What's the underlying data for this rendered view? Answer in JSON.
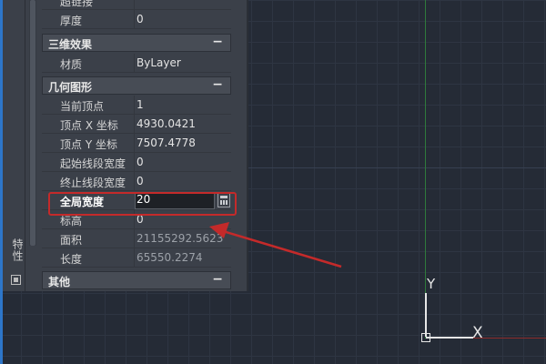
{
  "properties": {
    "rows_top": [
      {
        "label": "超链接",
        "value": ""
      },
      {
        "label": "厚度",
        "value": "0"
      }
    ],
    "section_3d": {
      "title": "三维效果",
      "toggle": "−"
    },
    "rows_3d": [
      {
        "label": "材质",
        "value": "ByLayer"
      }
    ],
    "section_geometry": {
      "title": "几何图形",
      "toggle": "−"
    },
    "rows_geometry": [
      {
        "label": "当前顶点",
        "value": "1"
      },
      {
        "label": "顶点 X 坐标",
        "value": "4930.0421"
      },
      {
        "label": "顶点 Y 坐标",
        "value": "7507.4778"
      },
      {
        "label": "起始线段宽度",
        "value": "0"
      },
      {
        "label": "终止线段宽度",
        "value": "0"
      },
      {
        "label": "全局宽度",
        "value": "20"
      },
      {
        "label": "标高",
        "value": "0"
      },
      {
        "label": "面积",
        "value": "21155292.5623"
      },
      {
        "label": "长度",
        "value": "65550.2274"
      }
    ],
    "section_other": {
      "title": "其他",
      "toggle": "−"
    }
  },
  "side_tab": {
    "label": "特性"
  },
  "ucs": {
    "x_label": "X",
    "y_label": "Y"
  },
  "colors": {
    "highlight": "#c42a2a",
    "canvas_bg": "#252b36",
    "panel_bg": "#3b4049",
    "accent_blue": "#2d76c9"
  },
  "icons": {
    "calculator": "calculator-icon",
    "side_panel": "panel-toggle-icon"
  }
}
